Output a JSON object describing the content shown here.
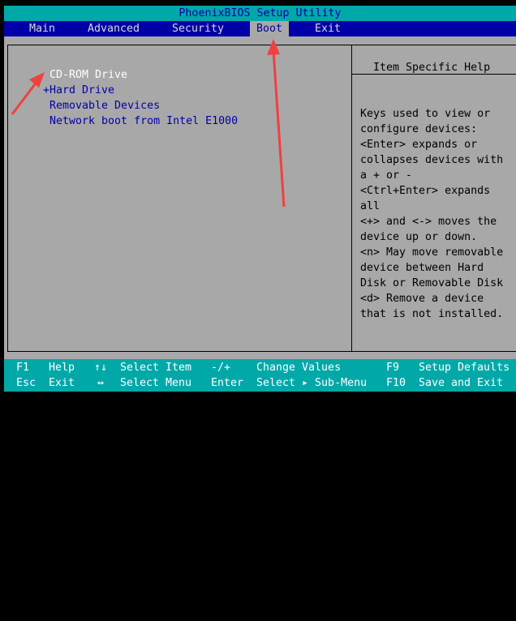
{
  "title": "PhoenixBIOS Setup Utility",
  "menu": [
    {
      "label": "Main"
    },
    {
      "label": "Advanced"
    },
    {
      "label": "Security"
    },
    {
      "label": "Boot",
      "active": true
    },
    {
      "label": "Exit"
    }
  ],
  "boot_items": [
    {
      "label": "CD-ROM Drive",
      "selected": true
    },
    {
      "label": "+Hard Drive"
    },
    {
      "label": "Removable Devices"
    },
    {
      "label": "Network boot from Intel E1000"
    }
  ],
  "help": {
    "title": "Item Specific Help",
    "lines": [
      "Keys used to view or",
      "configure devices:",
      "<Enter> expands or",
      "collapses devices with",
      "a + or -",
      "<Ctrl+Enter> expands",
      "all",
      "<+> and <-> moves the",
      "device up or down.",
      "<n> May move removable",
      "device between Hard",
      "Disk or Removable Disk",
      "<d> Remove a device",
      "that is not installed."
    ]
  },
  "footer": {
    "row1": [
      {
        "key": "F1",
        "action": "Help"
      },
      {
        "key": "↑↓",
        "action": "Select Item"
      },
      {
        "key": "-/+",
        "action": "Change Values"
      },
      {
        "key": "F9",
        "action": "Setup Defaults"
      }
    ],
    "row2": [
      {
        "key": "Esc",
        "action": "Exit"
      },
      {
        "key": "↔",
        "action": "Select Menu"
      },
      {
        "key": "Enter",
        "action": "Select ▸ Sub-Menu"
      },
      {
        "key": "F10",
        "action": "Save and Exit"
      }
    ]
  },
  "colors": {
    "teal": "#00a8a8",
    "blue": "#0000a8",
    "gray": "#a8a8a8",
    "annotation": "#f04040"
  }
}
